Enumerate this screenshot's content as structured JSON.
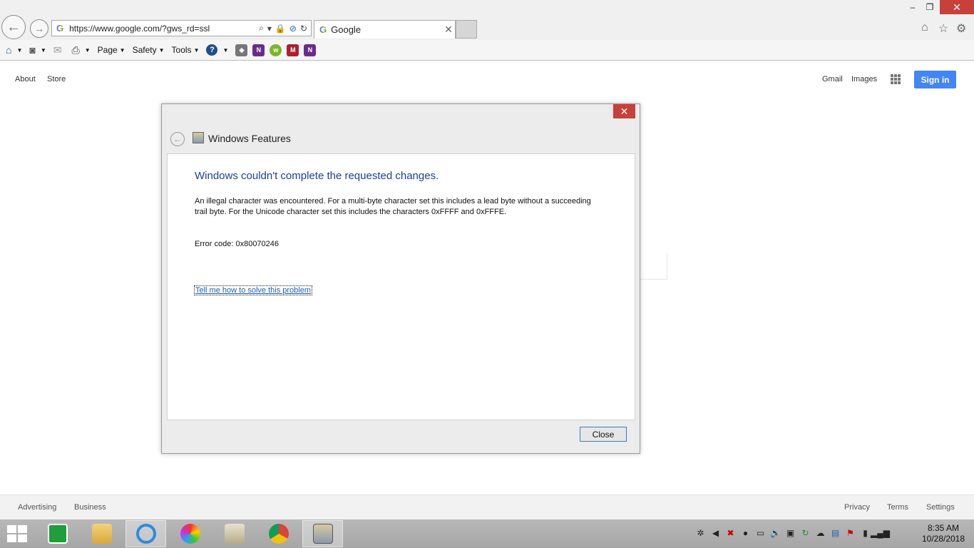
{
  "browser": {
    "url": "https://www.google.com/?gws_rd=ssl",
    "tab_title": "Google",
    "window_controls": {
      "minimize": "–",
      "maximize": "❐",
      "close": "✕"
    },
    "command_bar": {
      "page_label": "Page",
      "safety_label": "Safety",
      "tools_label": "Tools"
    }
  },
  "google": {
    "top_left_links": [
      "About",
      "Store"
    ],
    "top_right_links": [
      "Gmail",
      "Images"
    ],
    "sign_in_label": "Sign in",
    "footer_left": [
      "Advertising",
      "Business"
    ],
    "footer_right": [
      "Privacy",
      "Terms",
      "Settings"
    ]
  },
  "dialog": {
    "title": "Windows Features",
    "heading": "Windows couldn't complete the requested changes.",
    "message": "An illegal character was encountered. For a multi-byte character set this includes a lead byte without a succeeding trail byte. For the Unicode character set this includes the characters 0xFFFF and 0xFFFE.",
    "error_code": "Error code: 0x80070246",
    "help_link": "Tell me how to solve this problem",
    "close_label": "Close",
    "close_glyph": "✕"
  },
  "taskbar": {
    "time": "8:35 AM",
    "date": "10/28/2018"
  },
  "colors": {
    "accent_blue": "#4285f4",
    "dialog_heading": "#1e3f9a",
    "close_red": "#c7403a",
    "link": "#1a5fb4"
  }
}
